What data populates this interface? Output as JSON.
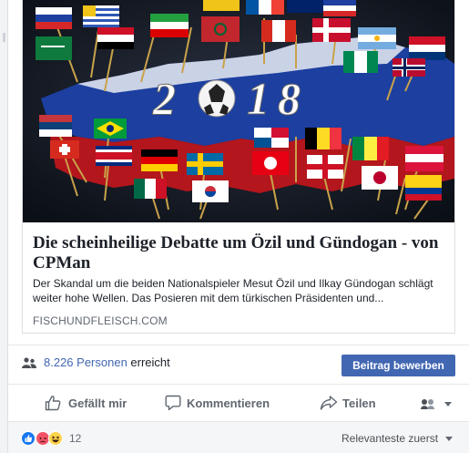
{
  "link_preview": {
    "image_caption": "2018",
    "title": "Die scheinheilige Debatte um Özil und Gündogan - von CPMan",
    "description": "Der Skandal um die beiden Nationalspieler Mesut Özil und Ilkay Gündogan schlägt weiter hohe Wellen. Das Posieren mit dem türkischen Präsidenten und...",
    "domain": "FISCHUNDFLEISCH.COM"
  },
  "reach": {
    "count_label": "8.226 Personen",
    "suffix": " erreicht",
    "icon": "people-icon",
    "promote_label": "Beitrag bewerben"
  },
  "actions": {
    "like_label": "Gefällt mir",
    "comment_label": "Kommentieren",
    "share_label": "Teilen",
    "like_icon": "thumbs-up-icon",
    "comment_icon": "speech-bubble-icon",
    "share_icon": "share-arrow-icon"
  },
  "footer": {
    "reactions": [
      "like",
      "angry",
      "haha"
    ],
    "reaction_count": "12",
    "sort_label": "Relevanteste zuerst"
  },
  "colors": {
    "accent": "#4267b2",
    "secondary_text": "#606770",
    "divider": "#e5e6e9"
  }
}
